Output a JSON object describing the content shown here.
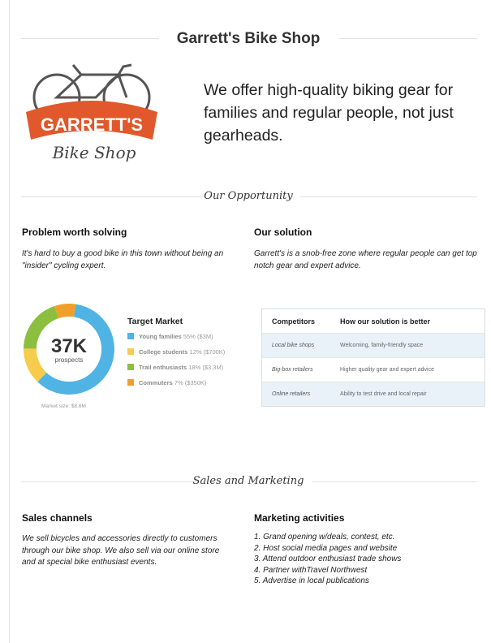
{
  "header": {
    "title": "Garrett's Bike Shop"
  },
  "logo": {
    "line1": "GARRETT'S",
    "line2": "Bike Shop"
  },
  "tagline": "We offer high-quality biking gear for families and regular people, not just gearheads.",
  "opportunity": {
    "heading": "Our Opportunity",
    "problem_title": "Problem worth solving",
    "problem_text": "It's hard to buy a good bike in this town without being an \"insider\" cycling expert.",
    "solution_title": "Our solution",
    "solution_text": "Garrett's is a snob-free zone where regular people can get top notch gear and expert advice."
  },
  "market": {
    "big_number": "37K",
    "big_label": "prospects",
    "legend_title": "Target Market",
    "items": [
      {
        "name": "Young families",
        "detail": "55% ($3M)",
        "color": "#4fb4e3"
      },
      {
        "name": "College students",
        "detail": "12% ($700K)",
        "color": "#f5cc4b"
      },
      {
        "name": "Trail enthusiasts",
        "detail": "18% ($3.3M)",
        "color": "#8cbf3f"
      },
      {
        "name": "Commuters",
        "detail": "7% ($350K)",
        "color": "#f0a02a"
      }
    ],
    "market_size": "Market size: $8.6M"
  },
  "chart_data": {
    "type": "pie",
    "title": "Target Market",
    "categories": [
      "Young families",
      "College students",
      "Trail enthusiasts",
      "Commuters"
    ],
    "values": [
      55,
      12,
      18,
      7
    ],
    "colors": [
      "#4fb4e3",
      "#f5cc4b",
      "#8cbf3f",
      "#f0a02a"
    ],
    "center_label": "37K prospects",
    "legend_position": "right"
  },
  "competitors": {
    "headers": [
      "Competitors",
      "How our solution is better"
    ],
    "rows": [
      [
        "Local bike shops",
        "Welcoming, family-friendly space"
      ],
      [
        "Big-box retailers",
        "Higher quality gear and expert advice"
      ],
      [
        "Online retailers",
        "Ability to test drive and local repair"
      ]
    ]
  },
  "sales": {
    "heading": "Sales and Marketing",
    "channels_title": "Sales channels",
    "channels_text": "We sell bicycles and accessories directly to customers through our bike shop. We also sell via our online store and at special bike enthusiast events.",
    "activities_title": "Marketing activities",
    "activities": [
      "1. Grand opening w/deals, contest, etc.",
      "2. Host social media pages and website",
      "3. Attend outdoor enthusiast trade shows",
      "4. Partner withTravel Northwest",
      "5. Advertise in local publications"
    ]
  }
}
